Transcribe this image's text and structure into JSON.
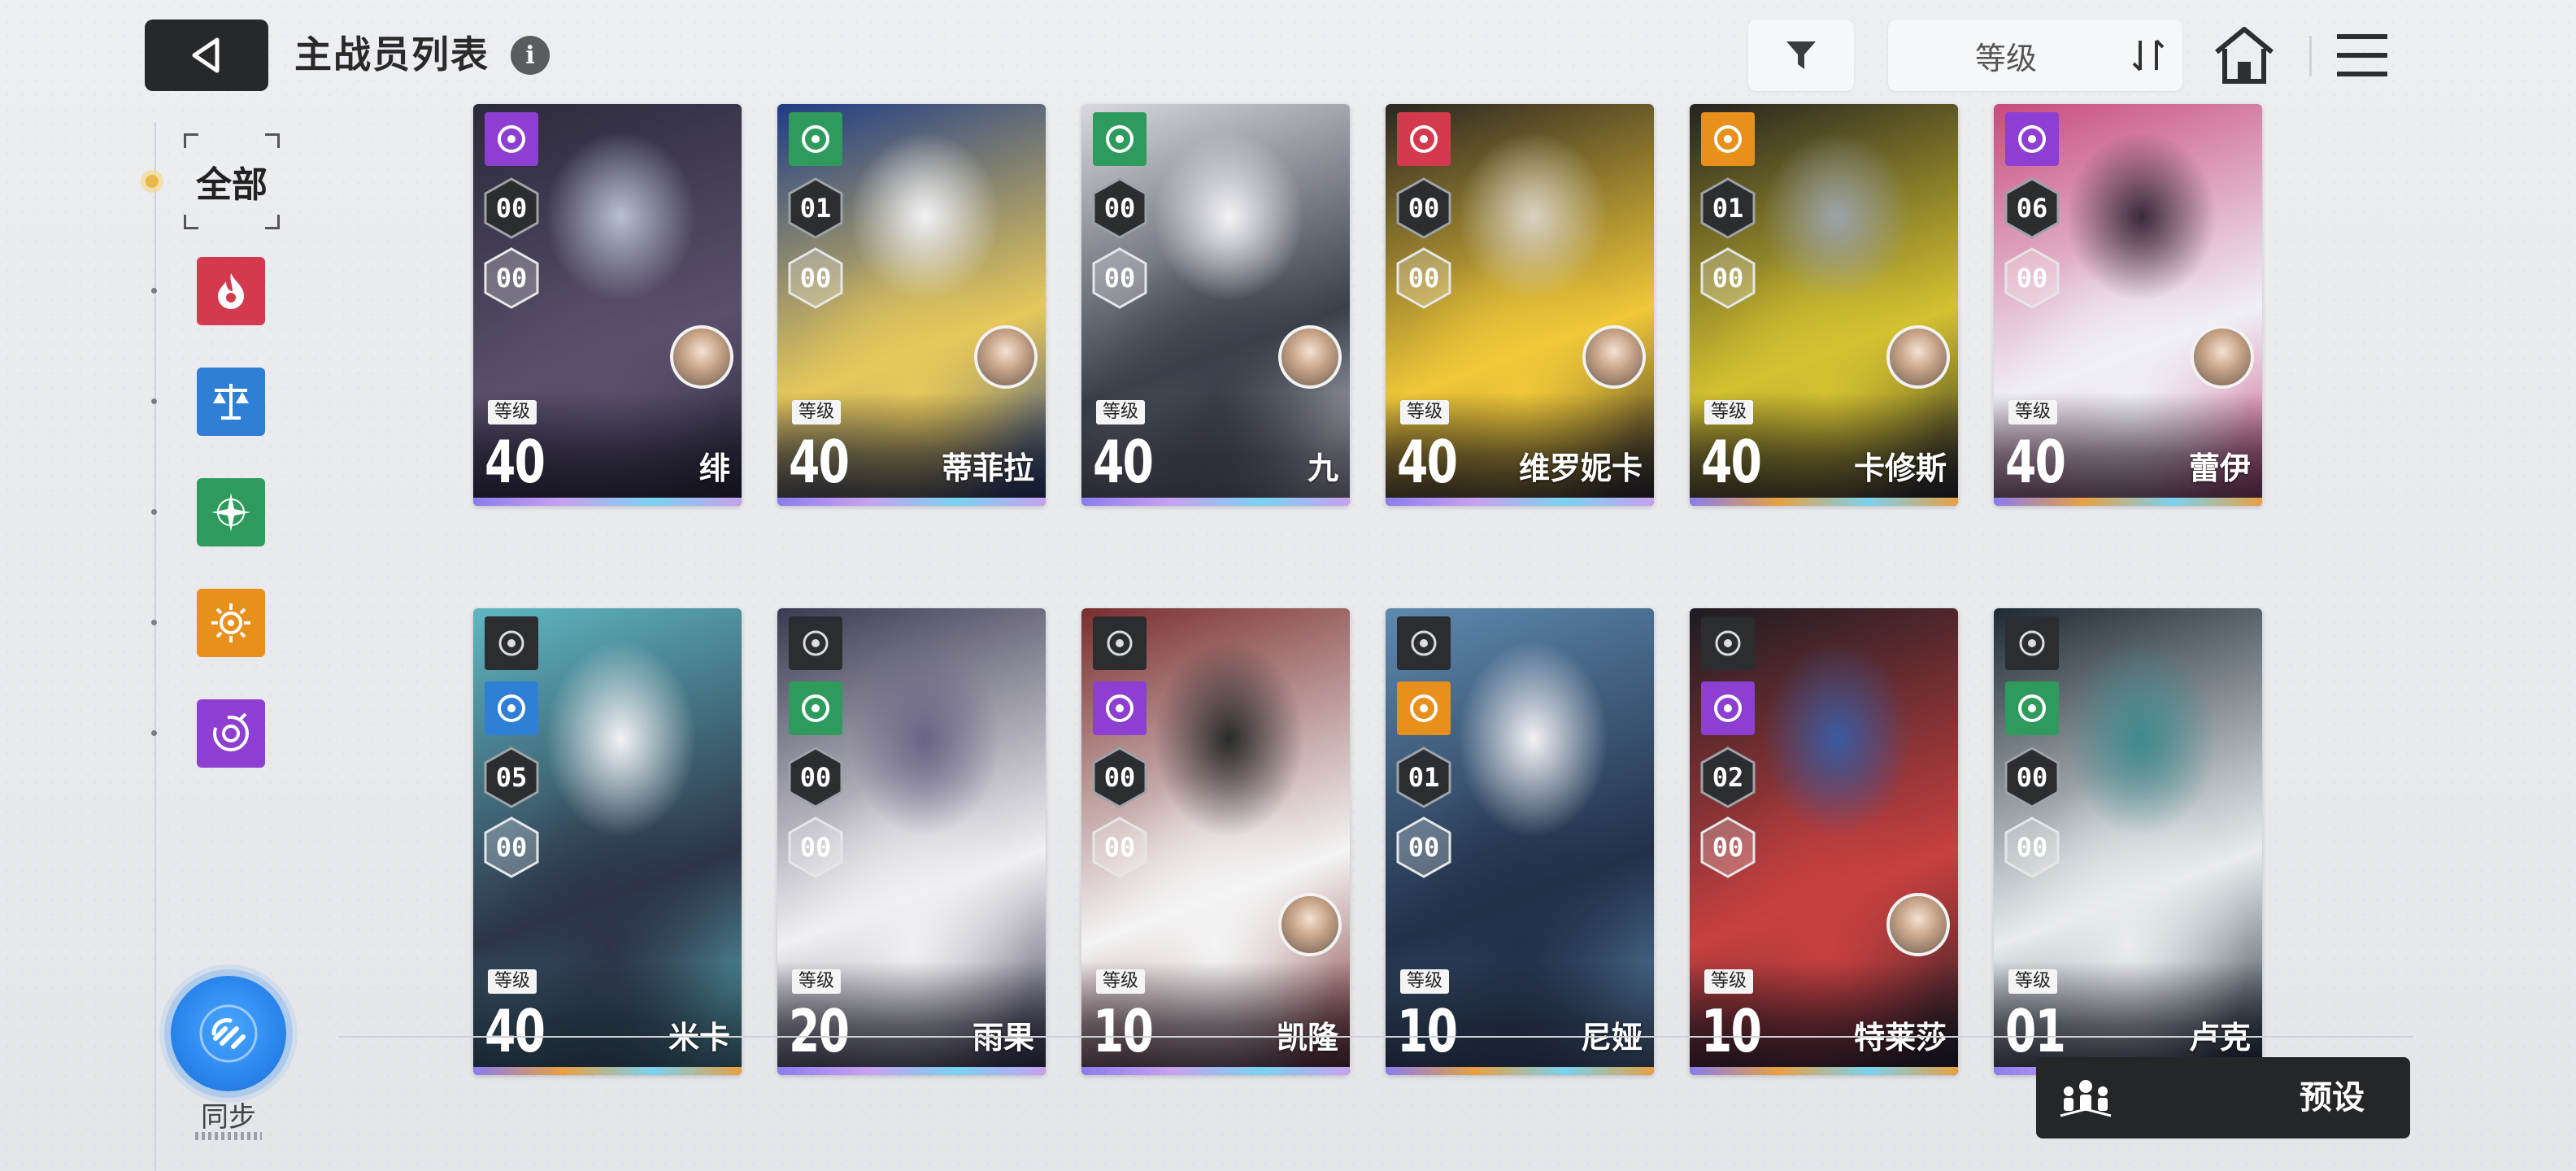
{
  "header": {
    "title": "主战员列表",
    "info_icon": "i",
    "sort_label": "等级"
  },
  "sidebar": {
    "all_label": "全部",
    "elements": [
      {
        "name": "fire-element",
        "color": "#d43a4e"
      },
      {
        "name": "balance-element",
        "color": "#2f7fd6"
      },
      {
        "name": "wind-element",
        "color": "#2e9b5c"
      },
      {
        "name": "sun-element",
        "color": "#e8901c"
      },
      {
        "name": "void-element",
        "color": "#8c3fd1"
      }
    ],
    "sync_label": "同步"
  },
  "level_tag": "等级",
  "cards": [
    {
      "name": "绯",
      "level": "40",
      "rank_top": "00",
      "rank_bottom": "00",
      "element": "#8c3fd1",
      "rarity": "#c9a0f0"
    },
    {
      "name": "蒂菲拉",
      "level": "40",
      "rank_top": "01",
      "rank_bottom": "00",
      "element": "#2e9b5c",
      "rarity": "#c9a0f0"
    },
    {
      "name": "九",
      "level": "40",
      "rank_top": "00",
      "rank_bottom": "00",
      "element": "#2e9b5c",
      "rarity": "#c9a0f0"
    },
    {
      "name": "维罗妮卡",
      "level": "40",
      "rank_top": "00",
      "rank_bottom": "00",
      "element": "#d43a4e",
      "rarity": "#c9a0f0"
    },
    {
      "name": "卡修斯",
      "level": "40",
      "rank_top": "01",
      "rank_bottom": "00",
      "element": "#e8901c",
      "rarity": "#e8a040"
    },
    {
      "name": "蕾伊",
      "level": "40",
      "rank_top": "06",
      "rank_bottom": "00",
      "element": "#8c3fd1",
      "rarity": "#e8a040"
    },
    {
      "name": "米卡",
      "level": "40",
      "rank_top": "05",
      "rank_bottom": "00",
      "element": "#2f7fd6",
      "rarity": "#e8a040"
    },
    {
      "name": "雨果",
      "level": "20",
      "rank_top": "00",
      "rank_bottom": "00",
      "element": "#2e9b5c",
      "rarity": "#c9a0f0"
    },
    {
      "name": "凯隆",
      "level": "10",
      "rank_top": "00",
      "rank_bottom": "00",
      "element": "#8c3fd1",
      "rarity": "#c9a0f0"
    },
    {
      "name": "尼娅",
      "level": "10",
      "rank_top": "01",
      "rank_bottom": "00",
      "element": "#e8901c",
      "rarity": "#e8a040"
    },
    {
      "name": "特莱莎",
      "level": "10",
      "rank_top": "02",
      "rank_bottom": "00",
      "element": "#8c3fd1",
      "rarity": "#e8a040"
    },
    {
      "name": "卢克",
      "level": "01",
      "rank_top": "00",
      "rank_bottom": "00",
      "element": "#2e9b5c",
      "rarity": "#c9a0f0"
    }
  ],
  "preset_label": "预设"
}
